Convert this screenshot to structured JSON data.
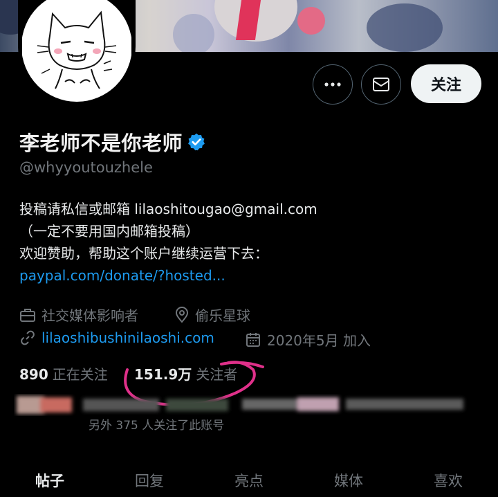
{
  "profile": {
    "display_name": "李老师不是你老师",
    "handle": "@whyyoutouzhele",
    "verified": true
  },
  "actions": {
    "more_icon": "more-horizontal-icon",
    "message_icon": "envelope-icon",
    "follow_label": "关注"
  },
  "bio": {
    "line1": "投稿请私信或邮箱 lilaoshitougao@gmail.com",
    "line2": "（一定不要用国内邮箱投稿）",
    "line3": "欢迎赞助，帮助这个账户继续运营下去：",
    "link": "paypal.com/donate/?hosted..."
  },
  "meta": {
    "category": "社交媒体影响者",
    "location": "偷乐星球",
    "website": "lilaoshibushinilaoshi.com",
    "joined": "2020年5月 加入"
  },
  "stats": {
    "following_count": "890",
    "following_label": "正在关注",
    "followers_count": "151.9万",
    "followers_label": "关注者"
  },
  "followed_by": {
    "text": "另外 375 人关注了此账号"
  },
  "tabs": [
    {
      "label": "帖子",
      "active": true
    },
    {
      "label": "回复",
      "active": false
    },
    {
      "label": "亮点",
      "active": false
    },
    {
      "label": "媒体",
      "active": false
    },
    {
      "label": "喜欢",
      "active": false
    }
  ],
  "colors": {
    "background": "#000000",
    "link": "#1d9bf0",
    "muted": "#71767b",
    "verified": "#1d9bf0",
    "annotation": "#e0308a"
  }
}
